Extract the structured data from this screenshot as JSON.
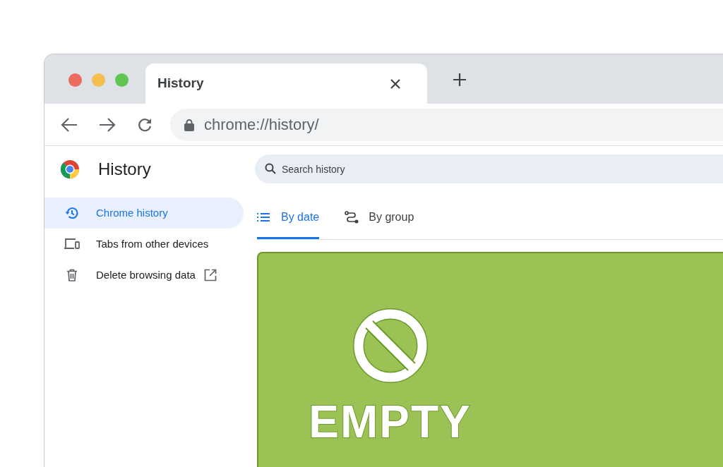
{
  "tabs": [
    {
      "title": "History",
      "selected": true
    }
  ],
  "address_bar": {
    "url": "chrome://history/",
    "secure": true
  },
  "page": {
    "title": "History",
    "search": {
      "placeholder": "Search history"
    },
    "sidebar": {
      "items": [
        {
          "label": "Chrome history",
          "kind": "history",
          "selected": true,
          "external": false
        },
        {
          "label": "Tabs from other devices",
          "kind": "devices",
          "selected": false,
          "external": false
        },
        {
          "label": "Delete browsing data",
          "kind": "delete",
          "selected": false,
          "external": true
        }
      ]
    },
    "view_tabs": [
      {
        "label": "By date",
        "kind": "list",
        "selected": true
      },
      {
        "label": "By group",
        "kind": "group",
        "selected": false
      }
    ],
    "empty_state": {
      "label": "EMPTY"
    }
  }
}
